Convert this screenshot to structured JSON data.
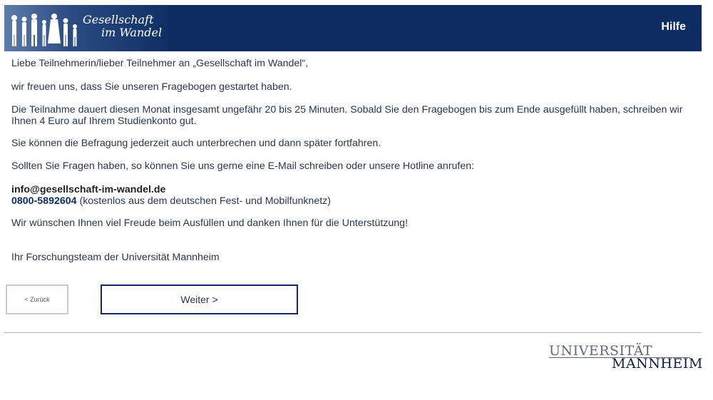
{
  "header": {
    "logo_line1": "Gesellschaft",
    "logo_line2": "im Wandel",
    "help_label": "Hilfe",
    "background_color": "#0d2d62"
  },
  "content": {
    "greeting": "Liebe Teilnehmerin/lieber Teilnehmer an „Gesellschaft im Wandel“,",
    "thanks": "wir freuen uns, dass Sie unseren Fragebogen gestartet haben.",
    "duration": "Die Teilnahme dauert diesen Monat insgesamt ungefähr 20 bis 25 Minuten. Sobald Sie den Fragebogen bis zum Ende ausgefüllt haben, schreiben wir Ihnen 4 Euro auf Ihrem Studienkonto gut.",
    "pause": "Sie können die Befragung jederzeit auch unterbrechen und dann später fortfahren.",
    "questions": "Sollten Sie Fragen haben, so können Sie uns gerne eine E-Mail schreiben oder unsere Hotline anrufen:",
    "email": "info@gesellschaft-im-wandel.de",
    "phone": "0800-5892604",
    "phone_note": " (kostenlos aus dem deutschen Fest- und Mobilfunknetz)",
    "wish": "Wir wünschen Ihnen viel Freude beim Ausfüllen und danken Ihnen für die Unterstützung!",
    "signature": "Ihr Forschungsteam der Universität Mannheim"
  },
  "nav": {
    "back_label": "< Zurück",
    "next_label": "Weiter >"
  },
  "footer": {
    "uni_line1": "UNIVERSITÄT",
    "uni_line2": "MANNHEIM"
  }
}
